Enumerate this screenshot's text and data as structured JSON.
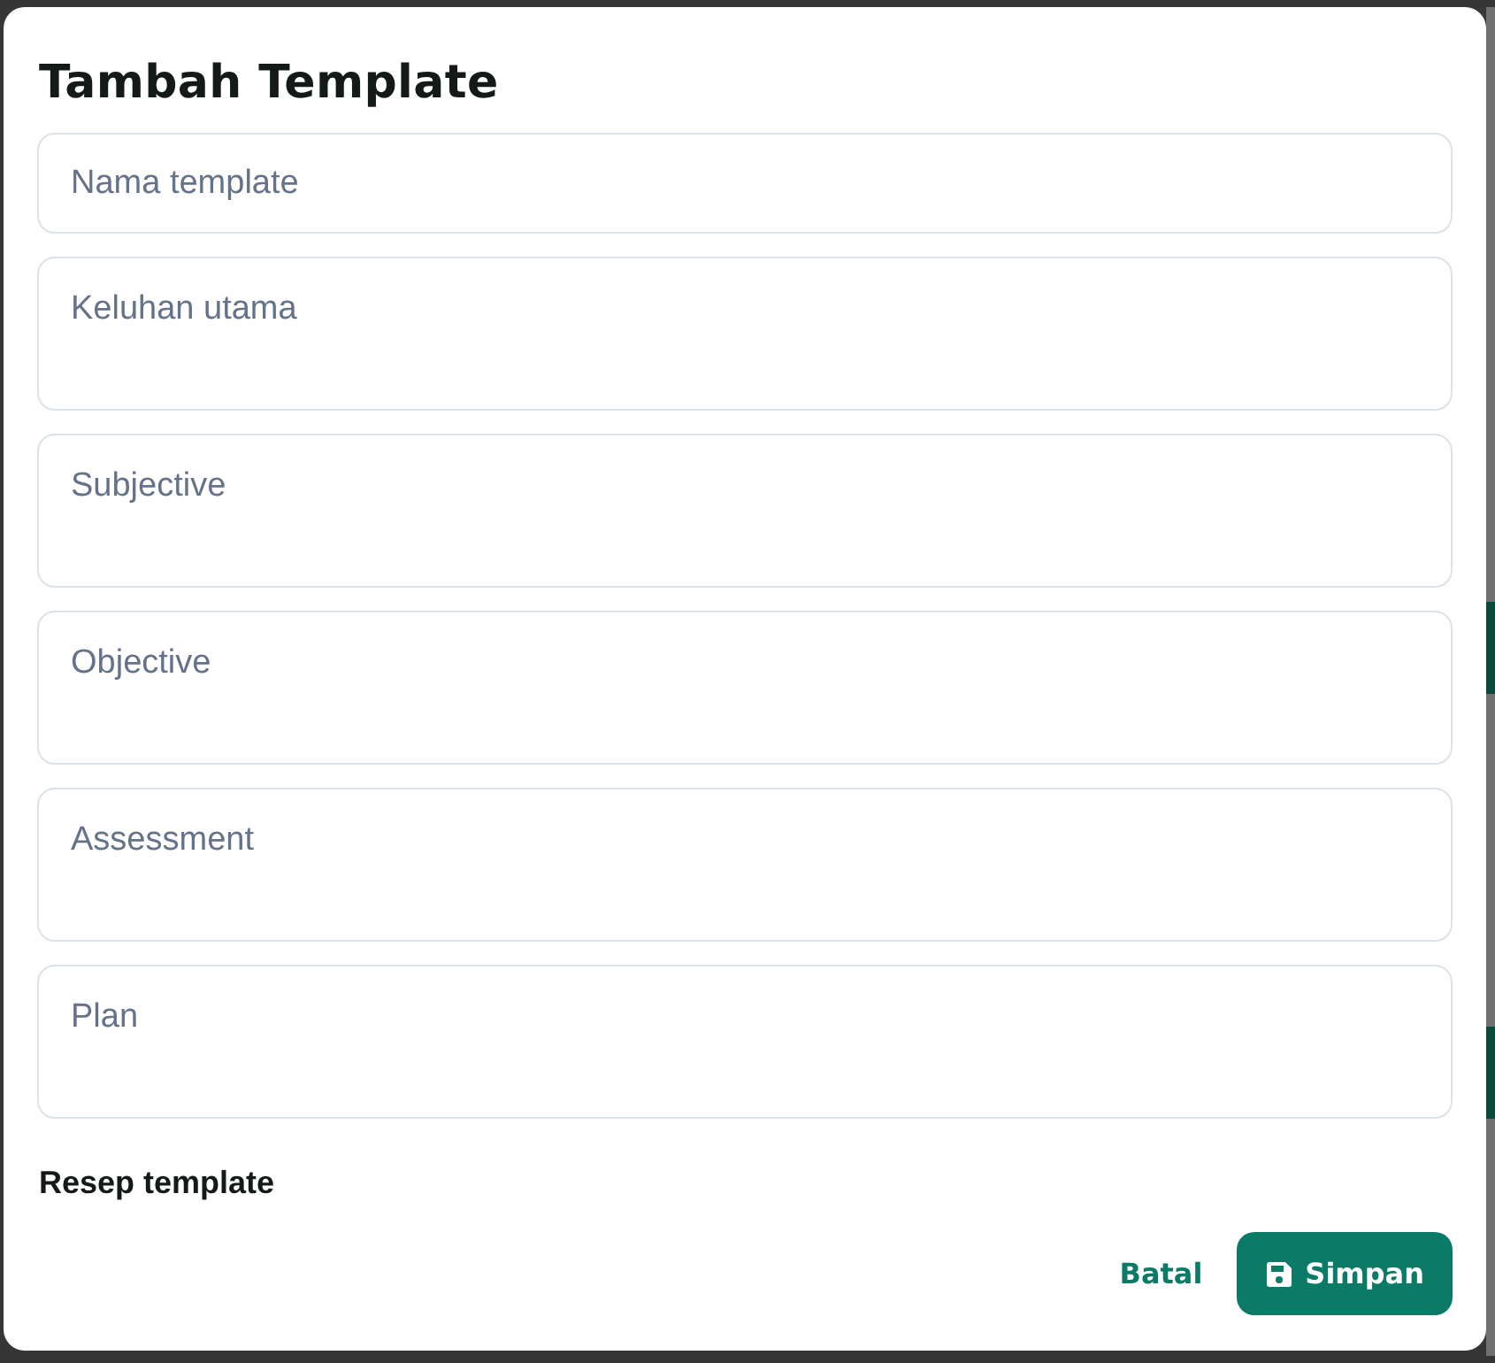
{
  "dialog": {
    "title": "Tambah Template"
  },
  "fields": [
    {
      "kind": "input",
      "placeholder": "Nama template"
    },
    {
      "kind": "textarea",
      "placeholder": "Keluhan utama"
    },
    {
      "kind": "textarea",
      "placeholder": "Subjective"
    },
    {
      "kind": "textarea",
      "placeholder": "Objective"
    },
    {
      "kind": "textarea",
      "placeholder": "Assessment"
    },
    {
      "kind": "textarea",
      "placeholder": "Plan"
    }
  ],
  "section_heading": "Resep template",
  "buttons": [
    {
      "kind": "text",
      "label": "Batal"
    },
    {
      "kind": "primary",
      "label": "Simpan"
    }
  ]
}
